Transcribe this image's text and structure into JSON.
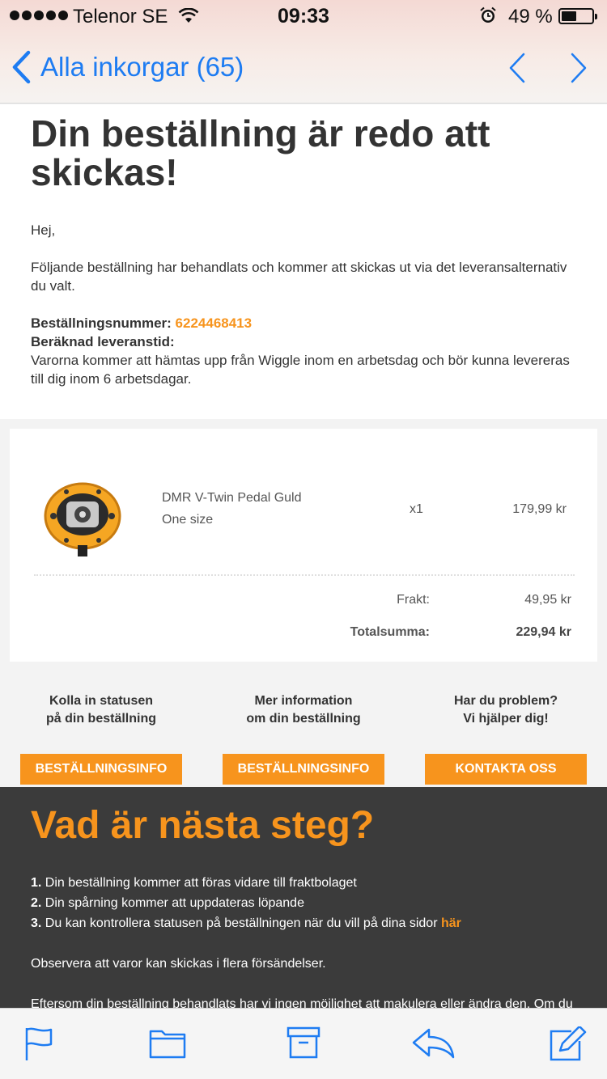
{
  "status_bar": {
    "carrier": "Telenor SE",
    "time": "09:33",
    "battery_percent": "49 %",
    "battery_level": 0.49
  },
  "nav": {
    "back_label": "Alla inkorgar (65)",
    "accent_color": "#1e7cf2"
  },
  "email": {
    "title": "Din beställning är redo att skickas!",
    "greeting": "Hej,",
    "body": "Följande beställning har behandlats och kommer att skickas ut via det leveransalternativ du valt.",
    "order_number_label": "Beställningsnummer:",
    "order_number": "6224468413",
    "delivery_label": "Beräknad leveranstid:",
    "delivery_text": "Varorna kommer att hämtas upp från Wiggle inom en arbetsdag och bör kunna levereras till dig inom 6 arbetsdagar."
  },
  "order": {
    "product_name": "DMR V-Twin Pedal Guld",
    "product_size": "One size",
    "quantity": "x1",
    "price": "179,99 kr",
    "shipping_label": "Frakt:",
    "shipping_value": "49,95 kr",
    "total_label": "Totalsumma:",
    "total_value": "229,94 kr"
  },
  "actions": [
    {
      "text_line1": "Kolla in statusen",
      "text_line2": "på din beställning",
      "button": "BESTÄLLNINGSINFO"
    },
    {
      "text_line1": "Mer information",
      "text_line2": "om din beställning",
      "button": "BESTÄLLNINGSINFO"
    },
    {
      "text_line1": "Har du problem?",
      "text_line2": "Vi hjälper dig!",
      "button": "KONTAKTA OSS"
    }
  ],
  "next_steps": {
    "title": "Vad är nästa steg?",
    "steps": [
      {
        "num": "1.",
        "text": " Din beställning kommer att föras vidare till fraktbolaget"
      },
      {
        "num": "2.",
        "text": " Din spårning kommer att uppdateras löpande"
      },
      {
        "num": "3.",
        "text": " Du kan kontrollera statusen på beställningen när du vill på dina sidor ",
        "link": "här"
      }
    ],
    "note": "Observera att varor kan skickas i flera försändelser.",
    "para": "Eftersom din beställning behandlats har vi ingen möjlighet att makulera eller ändra den. Om du ångrar dig och inte vill ha någon vara eller vill byta ut den mot någon"
  },
  "colors": {
    "brand_orange": "#f7941d",
    "dark_panel": "#3b3b3b"
  },
  "toolbar": {
    "icons": [
      "flag-icon",
      "folder-icon",
      "archive-icon",
      "reply-icon",
      "compose-icon"
    ]
  }
}
